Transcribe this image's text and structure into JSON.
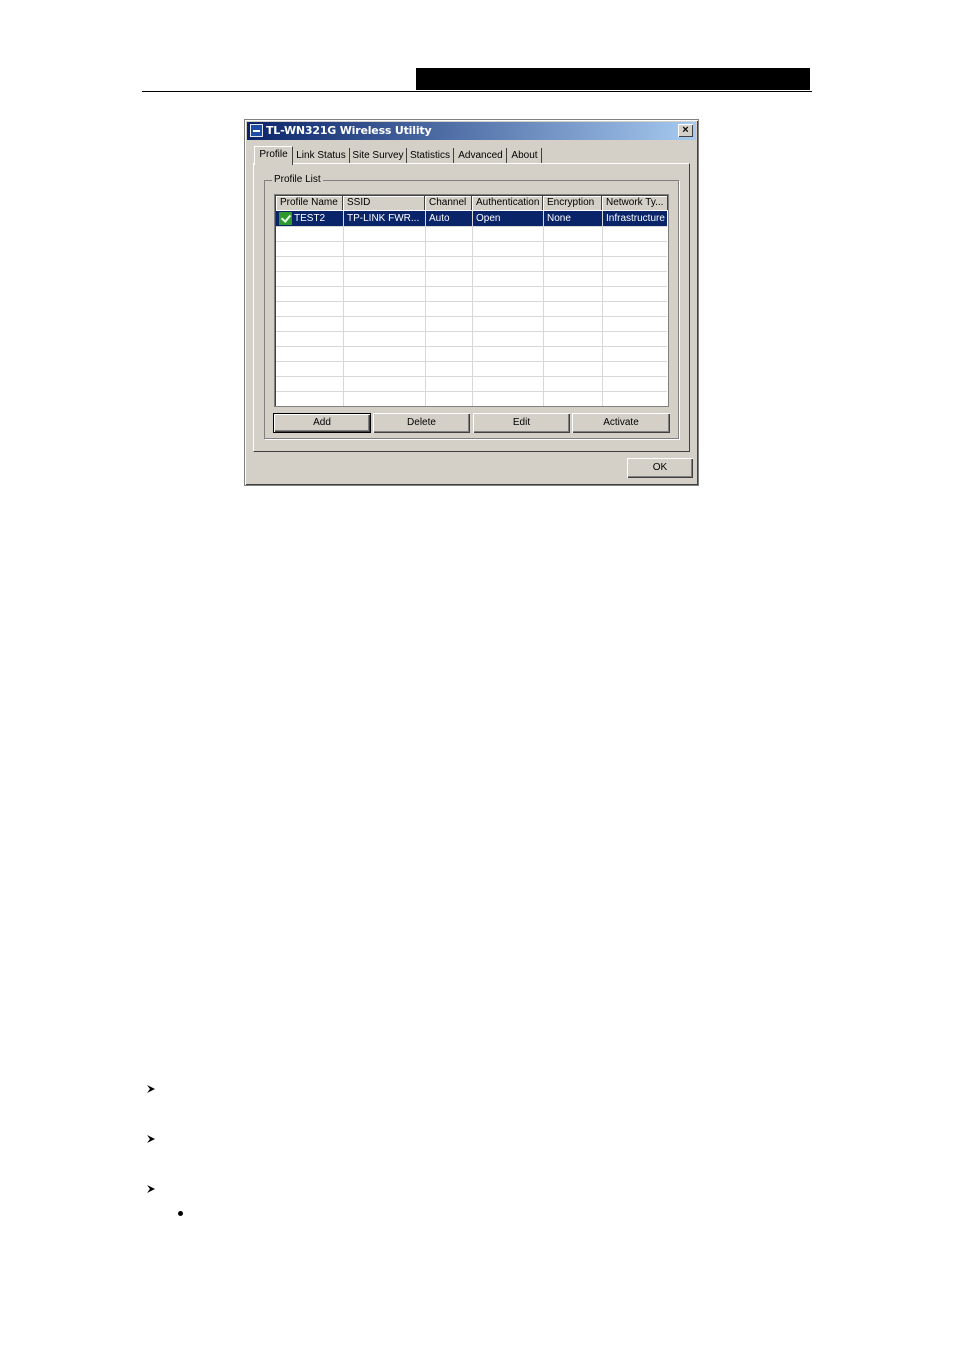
{
  "window": {
    "title": "TL-WN321G Wireless Utility",
    "close_glyph": "×"
  },
  "tabs": [
    "Profile",
    "Link Status",
    "Site Survey",
    "Statistics",
    "Advanced",
    "About"
  ],
  "active_tab": "Profile",
  "profile_list": {
    "group_label": "Profile List",
    "columns": [
      "Profile Name",
      "SSID",
      "Channel",
      "Authentication",
      "Encryption",
      "Network Ty..."
    ],
    "rows": [
      {
        "profile_name": "TEST2",
        "ssid": "TP-LINK FWR...",
        "channel": "Auto",
        "authentication": "Open",
        "encryption": "None",
        "network_type": "Infrastructure",
        "active_icon": "check-icon",
        "selected": true
      }
    ]
  },
  "buttons": {
    "add": "Add",
    "delete": "Delete",
    "edit": "Edit",
    "activate": "Activate",
    "ok": "OK"
  },
  "colors": {
    "selection": "#0a246a",
    "titlebar_start": "#0a246a",
    "titlebar_end": "#a6caf0",
    "face": "#d4d0c8"
  },
  "page_bullets": [
    "arrow-bullet-icon",
    "arrow-bullet-icon",
    "arrow-bullet-icon",
    "dot-bullet-icon"
  ]
}
